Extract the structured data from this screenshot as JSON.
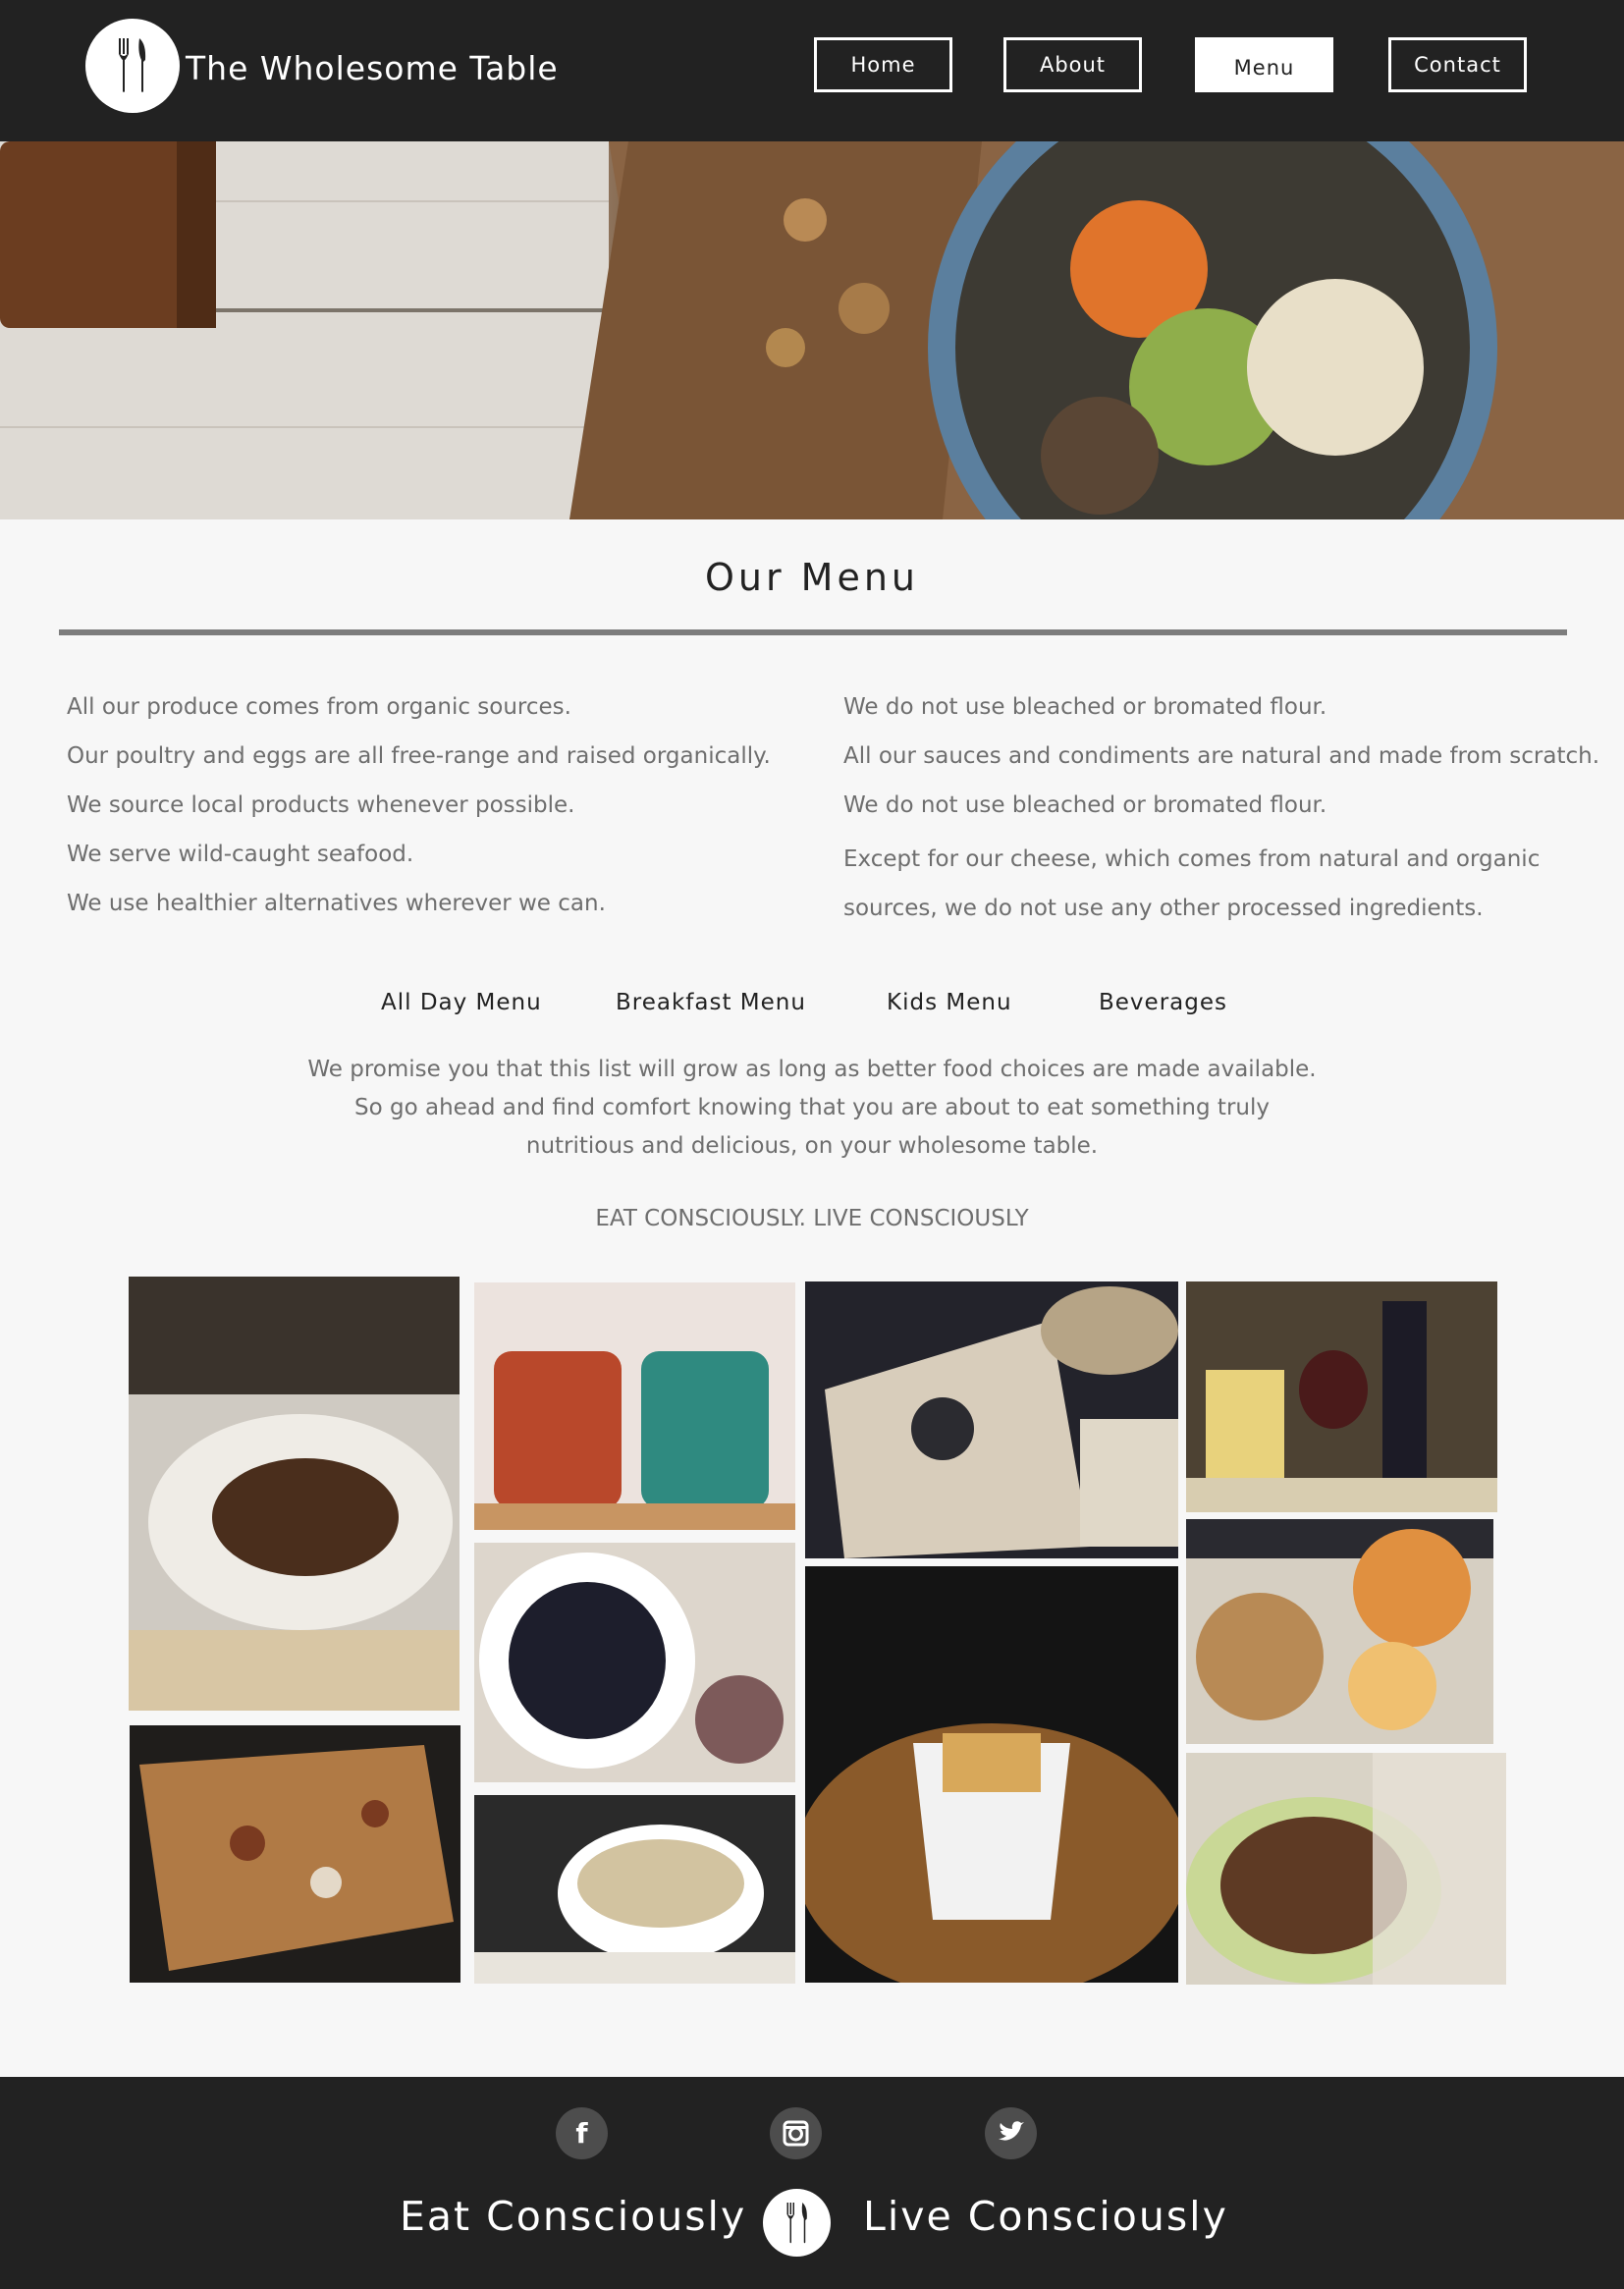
{
  "header": {
    "brand": "The Wholesome Table",
    "logo_icon": "fork-knife-icon",
    "nav": [
      {
        "label": "Home",
        "active": false
      },
      {
        "label": "About",
        "active": false
      },
      {
        "label": "Menu",
        "active": true
      },
      {
        "label": "Contact",
        "active": false
      }
    ]
  },
  "main": {
    "title": "Our Menu",
    "facts_left": [
      "All our produce comes from organic sources.",
      "Our poultry and eggs are all free-range and raised organically.",
      "We source local products whenever possible.",
      "We serve wild-caught seafood.",
      "We use healthier alternatives wherever we can."
    ],
    "facts_right": [
      "We do not use bleached or bromated flour.",
      "All our sauces and condiments are natural and made from scratch.",
      "We do not use bleached or bromated flour.",
      "Except for our cheese, which comes from natural and organic sources, we do not use any other processed ingredients."
    ],
    "menu_tabs": [
      "All Day Menu",
      "Breakfast Menu",
      "Kids Menu",
      "Beverages"
    ],
    "promise_lines": [
      "We promise you that this list will grow as long as better food choices are made available.",
      "So go ahead and find comfort knowing that you are about to eat something truly",
      "nutritious and delicious, on your wholesome table."
    ],
    "tagline": "EAT CONSCIOUSLY. LIVE CONSCIOUSLY"
  },
  "footer": {
    "social": [
      {
        "icon": "facebook-icon",
        "glyph": "f"
      },
      {
        "icon": "instagram-icon",
        "glyph": "◙"
      },
      {
        "icon": "twitter-icon",
        "glyph": "🐦"
      }
    ],
    "left_text": "Eat Consciously",
    "right_text": "Live Consciously"
  },
  "colors": {
    "header_bg": "#222222",
    "footer_bg": "#222222",
    "page_bg": "#f7f7f7",
    "body_text": "#6e6e6e"
  }
}
